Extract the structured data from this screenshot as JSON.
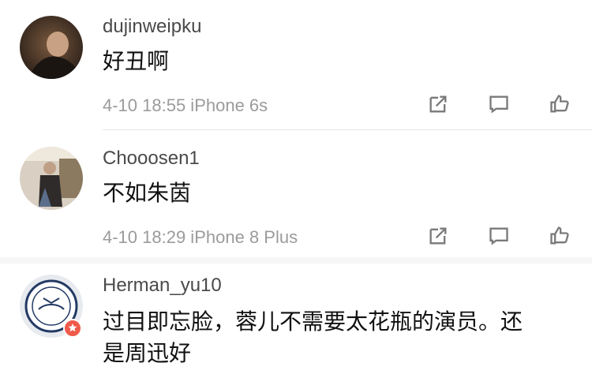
{
  "comments": [
    {
      "username": "dujinweipku",
      "content": "好丑啊",
      "meta": "4-10 18:55  iPhone 6s"
    },
    {
      "username": "Chooosen1",
      "content": "不如朱茵",
      "meta": "4-10 18:29  iPhone 8 Plus"
    },
    {
      "username": "Herman_yu10",
      "content_line1": "过目即忘脸，蓉儿不需要太花瓶的演员。还",
      "content_line2": "是周迅好"
    }
  ],
  "icons": {
    "share": "share-icon",
    "reply": "comment-icon",
    "like": "like-icon"
  }
}
